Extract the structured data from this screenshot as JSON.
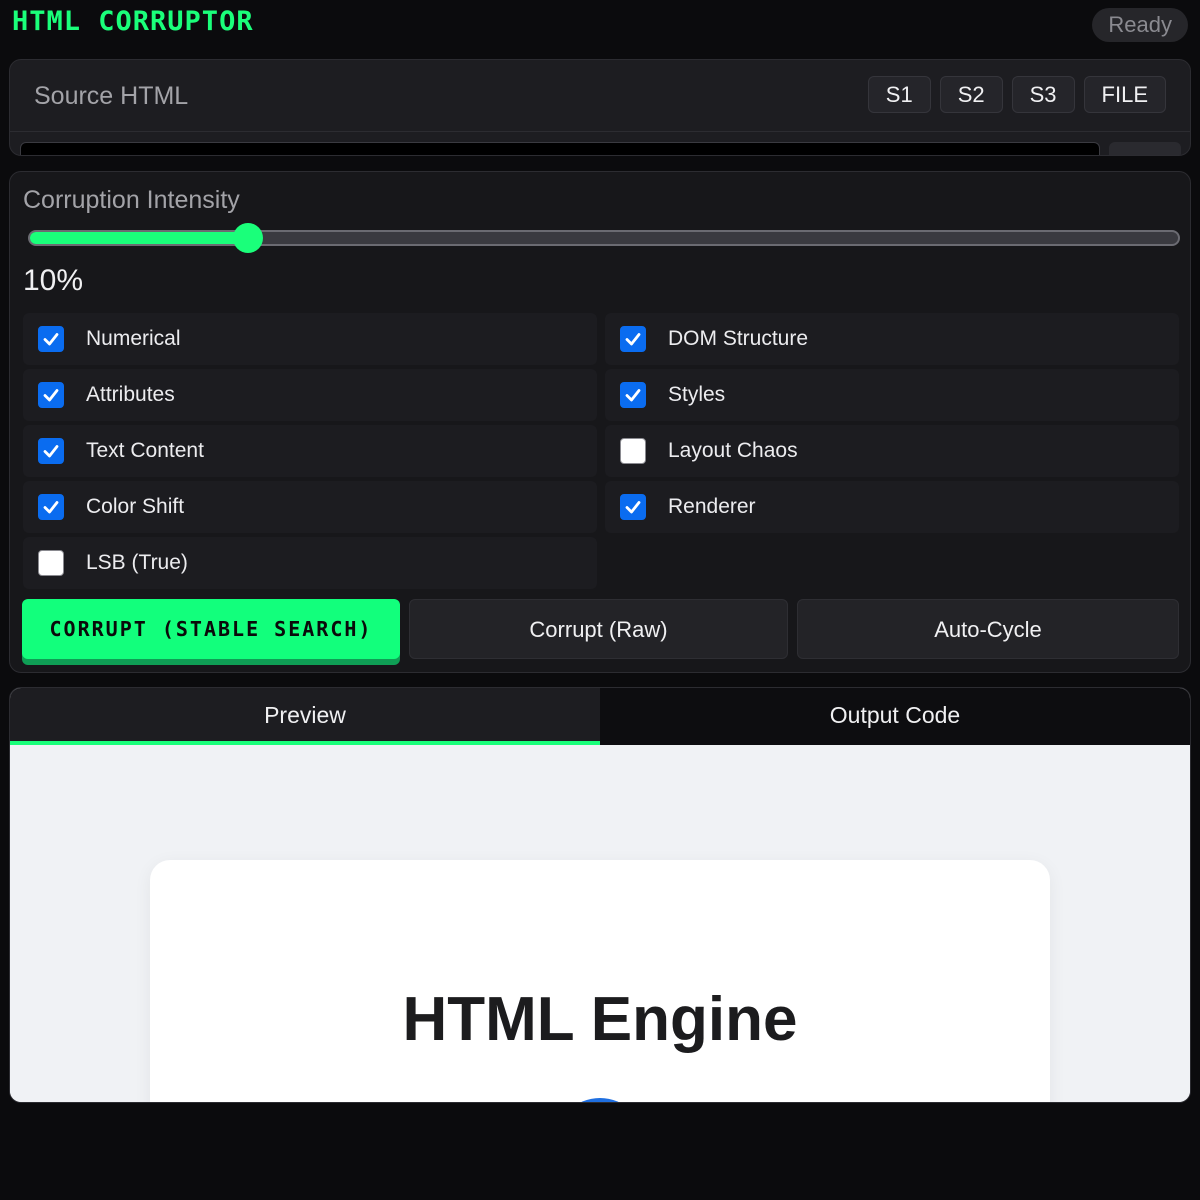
{
  "app": {
    "title": "HTML CORRUPTOR",
    "status": "Ready"
  },
  "source": {
    "title": "Source HTML",
    "buttons": [
      "S1",
      "S2",
      "S3",
      "FILE"
    ]
  },
  "intensity": {
    "label": "Corruption Intensity",
    "value_text": "10%",
    "slider_fraction": 0.19
  },
  "options": [
    {
      "label": "Numerical",
      "checked": true
    },
    {
      "label": "DOM Structure",
      "checked": true
    },
    {
      "label": "Attributes",
      "checked": true
    },
    {
      "label": "Styles",
      "checked": true
    },
    {
      "label": "Text Content",
      "checked": true
    },
    {
      "label": "Layout Chaos",
      "checked": false
    },
    {
      "label": "Color Shift",
      "checked": true
    },
    {
      "label": "Renderer",
      "checked": true
    },
    {
      "label": "LSB (True)",
      "checked": false
    }
  ],
  "actions": {
    "stable": "CORRUPT (STABLE SEARCH)",
    "raw": "Corrupt (Raw)",
    "auto": "Auto-Cycle"
  },
  "tabs": [
    {
      "label": "Preview",
      "active": true
    },
    {
      "label": "Output Code",
      "active": false
    }
  ],
  "preview": {
    "heading": "HTML Engine"
  },
  "colors": {
    "accent": "#1aff7a",
    "checkbox": "#0a6cf0",
    "background": "#0b0b0d"
  }
}
